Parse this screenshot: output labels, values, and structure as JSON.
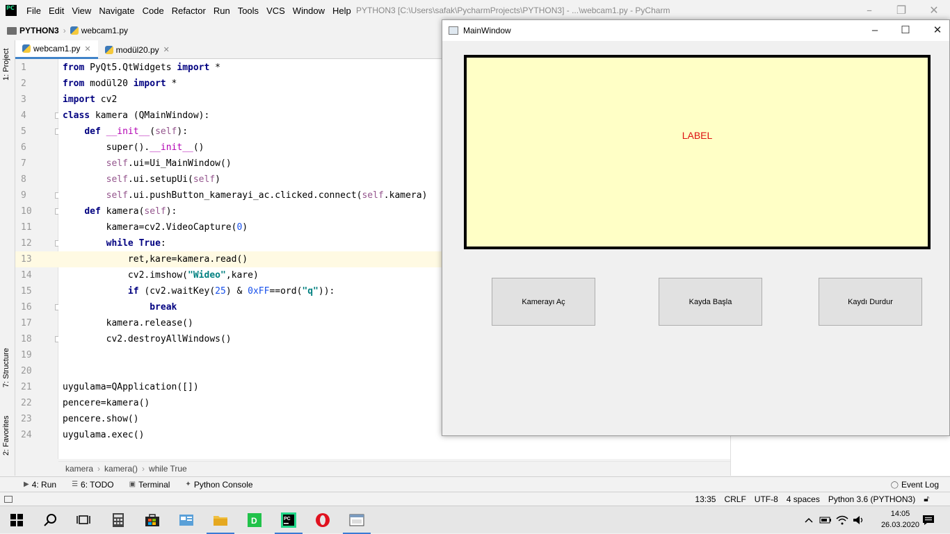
{
  "ide": {
    "menu": [
      "File",
      "Edit",
      "View",
      "Navigate",
      "Code",
      "Refactor",
      "Run",
      "Tools",
      "VCS",
      "Window",
      "Help"
    ],
    "title": "PYTHON3 [C:\\Users\\safak\\PycharmProjects\\PYTHON3] - ...\\webcam1.py - PyCharm",
    "logo": "PC",
    "breadcrumb": {
      "project": "PYTHON3",
      "file": "webcam1.py"
    },
    "tabs": [
      {
        "label": "webcam1.py",
        "active": true
      },
      {
        "label": "modül20.py",
        "active": false
      }
    ],
    "left_tools": [
      "1: Project",
      "7: Structure",
      "2: Favorites"
    ],
    "current_line": 13,
    "code_crumb": [
      "kamera",
      "kamera()",
      "while True"
    ],
    "bottom_tools": [
      "4: Run",
      "6: TODO",
      "Terminal",
      "Python Console"
    ],
    "event_log": "Event Log",
    "status": {
      "position": "13:35",
      "line_sep": "CRLF",
      "encoding": "UTF-8",
      "indent": "4 spaces",
      "interpreter": "Python 3.6 (PYTHON3)"
    }
  },
  "code_lines": [
    {
      "n": "1",
      "html": "<span class=\"kw\">from</span> PyQt5.QtWidgets <span class=\"kw\">import</span> *"
    },
    {
      "n": "2",
      "html": "<span class=\"kw\">from</span> modül20 <span class=\"kw\">import</span> *"
    },
    {
      "n": "3",
      "html": "<span class=\"kw\">import</span> cv2"
    },
    {
      "n": "4",
      "html": "<span class=\"kw\">class</span> kamera (QMainWindow):"
    },
    {
      "n": "5",
      "html": "    <span class=\"kw\">def</span> <span class=\"magic\">__init__</span>(<span class=\"self\">self</span>):"
    },
    {
      "n": "6",
      "html": "        super().<span class=\"magic\">__init__</span>()"
    },
    {
      "n": "7",
      "html": "        <span class=\"self\">self</span>.ui=Ui_MainWindow()"
    },
    {
      "n": "8",
      "html": "        <span class=\"self\">self</span>.ui.setupUi(<span class=\"self\">self</span>)"
    },
    {
      "n": "9",
      "html": "        <span class=\"self\">self</span>.ui.pushButton_kamerayi_ac.clicked.connect(<span class=\"self\">self</span>.kamera)"
    },
    {
      "n": "10",
      "html": "    <span class=\"kw\">def</span> kamera(<span class=\"self\">self</span>):"
    },
    {
      "n": "11",
      "html": "        kamera=cv2.VideoCapture(<span class=\"num\">0</span>)"
    },
    {
      "n": "12",
      "html": "        <span class=\"kw\">while True</span>:"
    },
    {
      "n": "13",
      "html": "            ret,kare=kamera.read()"
    },
    {
      "n": "14",
      "html": "            cv2.imshow(<span class=\"str\">\"Wideo\"</span>,kare)"
    },
    {
      "n": "15",
      "html": "            <span class=\"kw\">if</span> (cv2.waitKey(<span class=\"num\">25</span>) &amp; <span class=\"num\">0xFF</span>==ord(<span class=\"str\">\"q\"</span>)):"
    },
    {
      "n": "16",
      "html": "                <span class=\"kw\">break</span>"
    },
    {
      "n": "17",
      "html": "        kamera.release()"
    },
    {
      "n": "18",
      "html": "        cv2.destroyAllWindows()"
    },
    {
      "n": "19",
      "html": ""
    },
    {
      "n": "20",
      "html": ""
    },
    {
      "n": "21",
      "html": "uygulama=QApplication([])"
    },
    {
      "n": "22",
      "html": "pencere=kamera()"
    },
    {
      "n": "23",
      "html": "pencere.show()"
    },
    {
      "n": "24",
      "html": "uygulama.exec()"
    }
  ],
  "main_window": {
    "title": "MainWindow",
    "label": "LABEL",
    "buttons": [
      "Kamerayı Aç",
      "Kayda Başla",
      "Kaydı Durdur"
    ],
    "label_bg": "#ffffc6",
    "label_color": "#dd1111"
  },
  "taskbar": {
    "time": "14:05",
    "date": "26.03.2020"
  }
}
